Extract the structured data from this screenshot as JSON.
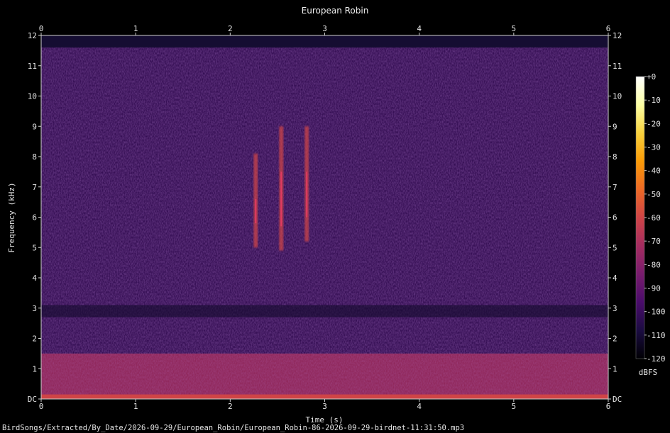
{
  "chart_data": {
    "type": "heatmap",
    "title": "European Robin",
    "xlabel": "Time (s)",
    "ylabel": "Frequency (kHz)",
    "x_range": [
      0,
      6
    ],
    "y_range": [
      0,
      12
    ],
    "x_ticks": [
      "0",
      "1",
      "2",
      "3",
      "4",
      "5",
      "6"
    ],
    "y_ticks": [
      "DC",
      "1",
      "2",
      "3",
      "4",
      "5",
      "6",
      "7",
      "8",
      "9",
      "10",
      "11",
      "12"
    ],
    "colorbar": {
      "label": "dBFS",
      "range": [
        -120,
        0
      ],
      "ticks": [
        "+0",
        "-10",
        "-20",
        "-30",
        "-40",
        "-50",
        "-60",
        "-70",
        "-80",
        "-90",
        "-100",
        "-110",
        "-120"
      ],
      "colors": [
        "#000004",
        "#1b0c41",
        "#4a0c6b",
        "#781c6d",
        "#a52c60",
        "#cf4446",
        "#ed6925",
        "#fb9b06",
        "#f7d13d",
        "#fcffa4",
        "#ffffff"
      ]
    },
    "background_level_dbfs": -95,
    "low_frequency_band": {
      "from_khz": 0,
      "to_khz": 1.5,
      "level_dbfs": -75
    },
    "dc_band": {
      "from_khz": 0,
      "to_khz": 0.15,
      "level_dbfs": -55
    },
    "bird_calls": [
      {
        "time_s": 2.27,
        "freq_low_khz": 5.0,
        "freq_high_khz": 8.1,
        "peak_dbfs": -60
      },
      {
        "time_s": 2.54,
        "freq_low_khz": 4.9,
        "freq_high_khz": 9.0,
        "peak_dbfs": -60
      },
      {
        "time_s": 2.81,
        "freq_low_khz": 5.2,
        "freq_high_khz": 9.0,
        "peak_dbfs": -65
      }
    ]
  },
  "footer": {
    "file_path": "BirdSongs/Extracted/By_Date/2026-09-29/European_Robin/European_Robin-86-2026-09-29-birdnet-11:31:50.mp3"
  }
}
